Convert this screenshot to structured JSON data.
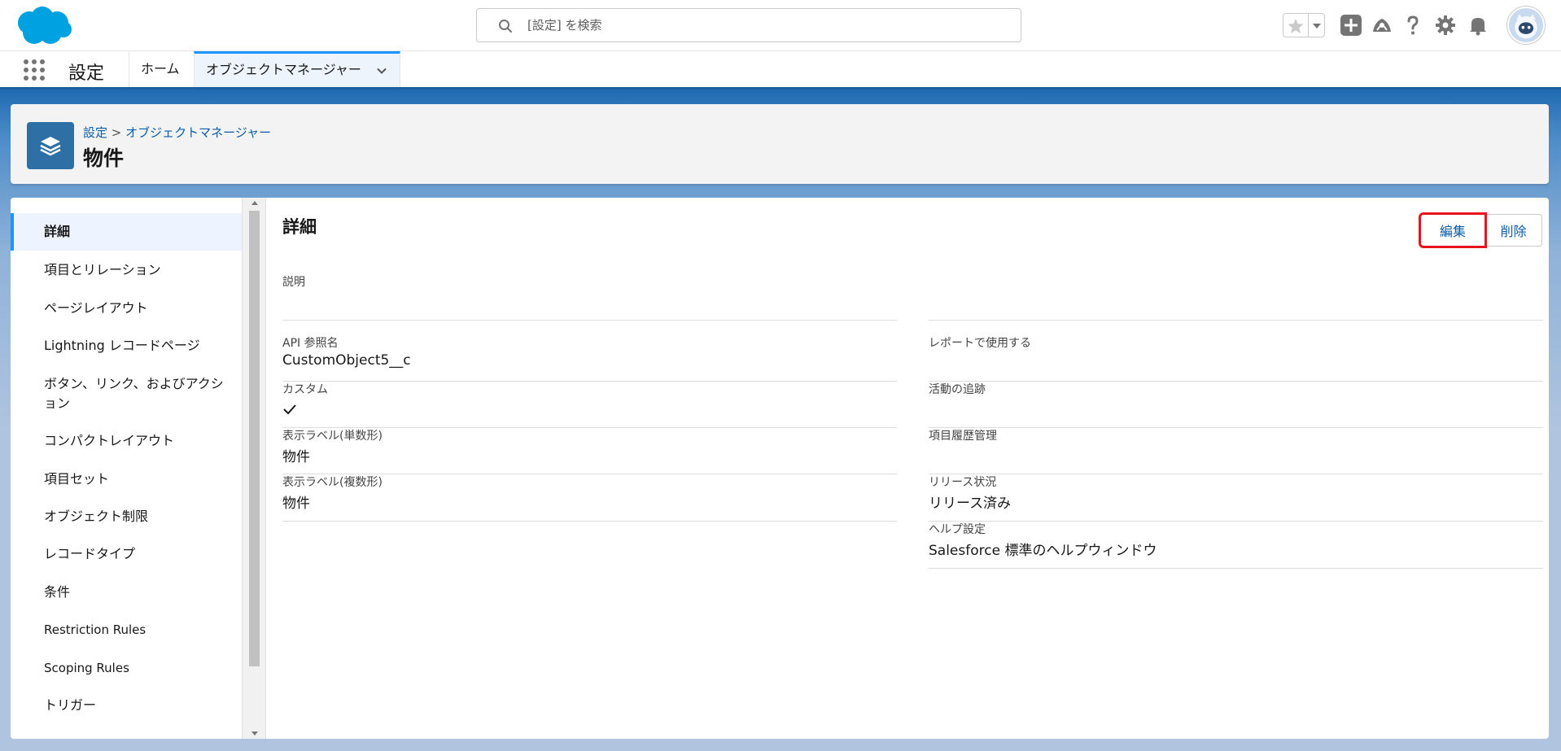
{
  "search": {
    "placeholder": "[設定] を検索"
  },
  "app": {
    "name": "設定"
  },
  "nav_tabs": [
    {
      "label": "ホーム"
    },
    {
      "label": "オブジェクトマネージャー"
    }
  ],
  "page_header": {
    "breadcrumb_root": "設定",
    "breadcrumb_sep": ">",
    "breadcrumb_current": "オブジェクトマネージャー",
    "title": "物件"
  },
  "sidenav": {
    "items": [
      {
        "label": "詳細"
      },
      {
        "label": "項目とリレーション"
      },
      {
        "label": "ページレイアウト"
      },
      {
        "label": "Lightning レコードページ"
      },
      {
        "label": "ボタン、リンク、およびアクション"
      },
      {
        "label": "コンパクトレイアウト"
      },
      {
        "label": "項目セット"
      },
      {
        "label": "オブジェクト制限"
      },
      {
        "label": "レコードタイプ"
      },
      {
        "label": "条件"
      },
      {
        "label": "Restriction Rules"
      },
      {
        "label": "Scoping Rules"
      },
      {
        "label": "トリガー"
      }
    ]
  },
  "detail": {
    "section_title": "詳細",
    "edit_label": "編集",
    "delete_label": "削除",
    "fields_left": [
      {
        "label": "説明",
        "value": ""
      },
      {
        "label": "API 参照名",
        "value": "CustomObject5__c"
      },
      {
        "label": "カスタム",
        "value": "",
        "checked": true
      },
      {
        "label": "表示ラベル(単数形)",
        "value": "物件"
      },
      {
        "label": "表示ラベル(複数形)",
        "value": "物件"
      }
    ],
    "fields_right": [
      {
        "label": "",
        "value": ""
      },
      {
        "label": "レポートで使用する",
        "value": ""
      },
      {
        "label": "活動の追跡",
        "value": ""
      },
      {
        "label": "項目履歴管理",
        "value": ""
      },
      {
        "label": "リリース状況",
        "value": "リリース済み"
      },
      {
        "label": "ヘルプ設定",
        "value": "Salesforce 標準のヘルプウィンドウ"
      }
    ]
  },
  "colors": {
    "brand": "#0176d3",
    "accent": "#1b96ff",
    "link": "#0b5cab",
    "highlight": "#e8141b"
  }
}
